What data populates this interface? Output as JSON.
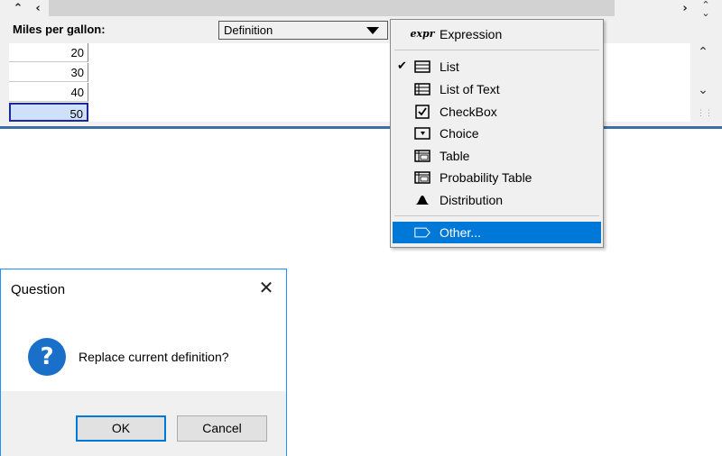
{
  "window": {
    "index_label": "Miles per gallon:",
    "definition_select": {
      "selected": "Definition"
    },
    "cells": [
      "20",
      "30",
      "40",
      "50"
    ],
    "selected_cell_index": 3
  },
  "menu": {
    "items": [
      {
        "label": "Expression",
        "icon": "expr-icon",
        "icon_text": "expr",
        "checked": false,
        "highlighted": false
      },
      {
        "label": "List",
        "icon": "list-icon",
        "checked": true,
        "highlighted": false
      },
      {
        "label": "List of Text",
        "icon": "list-of-text-icon",
        "checked": false,
        "highlighted": false
      },
      {
        "label": "CheckBox",
        "icon": "checkbox-icon",
        "checked": false,
        "highlighted": false
      },
      {
        "label": "Choice",
        "icon": "choice-icon",
        "checked": false,
        "highlighted": false
      },
      {
        "label": "Table",
        "icon": "table-icon",
        "checked": false,
        "highlighted": false
      },
      {
        "label": "Probability Table",
        "icon": "probability-table-icon",
        "checked": false,
        "highlighted": false
      },
      {
        "label": "Distribution",
        "icon": "distribution-icon",
        "checked": false,
        "highlighted": false
      },
      {
        "label": "Other...",
        "icon": "other-icon",
        "checked": false,
        "highlighted": true
      }
    ],
    "colors": {
      "highlight": "#0078d7"
    }
  },
  "dialog": {
    "title": "Question",
    "message": "Replace current definition?",
    "ok_label": "OK",
    "cancel_label": "Cancel",
    "colors": {
      "border": "#1e90ff",
      "icon": "#1a6fc8"
    }
  }
}
